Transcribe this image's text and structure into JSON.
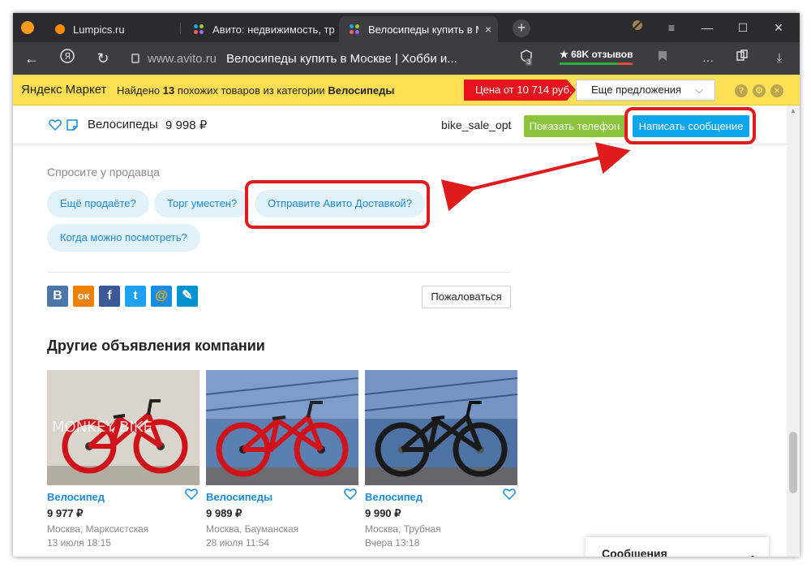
{
  "browser": {
    "tabs": [
      {
        "title": "Lumpics.ru"
      },
      {
        "title": "Авито: недвижимость, тра"
      },
      {
        "title": "Велосипеды купить в М"
      }
    ],
    "close_glyph": "×",
    "new_tab_glyph": "+",
    "address": {
      "domain": "www.avito.ru",
      "title": "Велосипеды купить в Москве | Хобби и..."
    },
    "tab_count": "3",
    "reviews": "★ 68K отзывов",
    "window_controls": {
      "menu": "≡",
      "minimize": "—",
      "maximize": "☐",
      "close": "✕"
    }
  },
  "market_bar": {
    "logo": "Яндекс Маркет",
    "found_prefix": "Найдено",
    "found_count": "13",
    "found_middle": "похожих товаров из категории",
    "found_category": "Велосипеды",
    "price_label": "Цена от 10 714 руб.",
    "more_label": "Еще предложения",
    "help": "?",
    "settings": "⚙",
    "close": "×"
  },
  "listing": {
    "title": "Велосипеды",
    "price": "9 998  ₽",
    "seller": "bike_sale_opt",
    "phone_button": "Показать телефон",
    "message_button": "Написать сообщение"
  },
  "ask_seller": {
    "heading": "Спросите у продавца",
    "chips": [
      "Ещё продаёте?",
      "Торг уместен?",
      "Отправите Авито Доставкой?",
      "Когда можно посмотреть?"
    ]
  },
  "social": {
    "buttons": [
      {
        "label": "В",
        "icon": "vk-icon",
        "color": "#4a76a8"
      },
      {
        "label": "ок",
        "icon": "odnoklassniki-icon",
        "color": "#ee8208"
      },
      {
        "label": "f",
        "icon": "facebook-icon",
        "color": "#3b5998"
      },
      {
        "label": "t",
        "icon": "twitter-icon",
        "color": "#1da1f2"
      },
      {
        "label": "@",
        "icon": "mail-icon",
        "color": "#168de2"
      },
      {
        "label": "✎",
        "icon": "livejournal-icon",
        "color": "#0093d0"
      }
    ],
    "complain_button": "Пожаловаться"
  },
  "other_ads": {
    "heading": "Другие объявления компании",
    "cards": [
      {
        "name": "Велосипед",
        "price": "9 977 ₽",
        "location": "Москва, Марксистская",
        "date": "13 июля 18:15",
        "watermark": "MONKEY BIKE"
      },
      {
        "name": "Велосипеды",
        "price": "9 989 ₽",
        "location": "Москва, Бауманская",
        "date": "28 июля 11:54"
      },
      {
        "name": "Велосипед",
        "price": "9 990 ₽",
        "location": "Москва, Трубная",
        "date": "Вчера 13:18"
      }
    ]
  },
  "messages_panel": {
    "label": "Сообщения",
    "chevron": "︿"
  },
  "colors": {
    "accent_blue": "#0ca6ec",
    "phone_green": "#8cc43d",
    "highlight_red": "#e01b1b",
    "market_yellow": "#fdde55"
  }
}
